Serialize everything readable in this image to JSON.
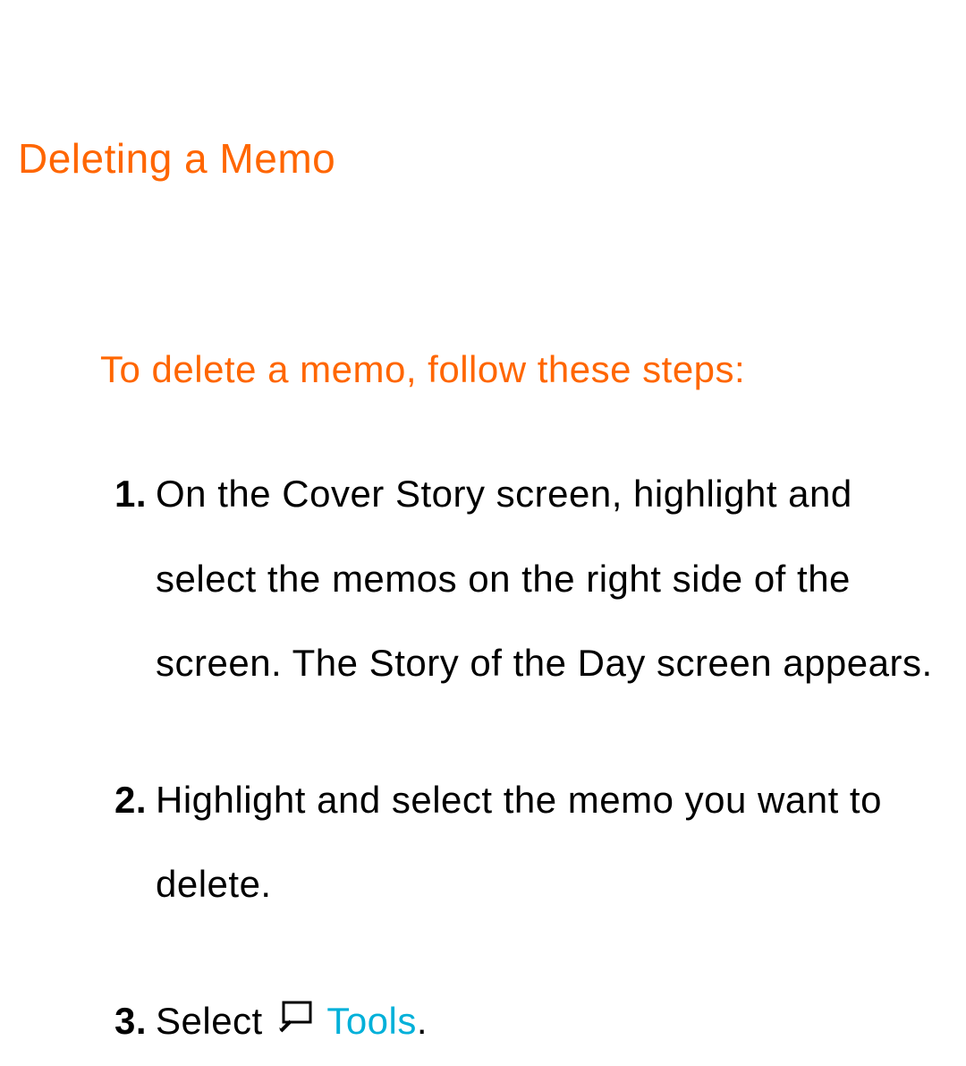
{
  "heading": "Deleting a Memo",
  "intro": "To delete a memo, follow these steps:",
  "steps": {
    "step1": "On the Cover Story screen, highlight and select the memos on the right side of the screen. The Story of the Day screen appears.",
    "step2": "Highlight and select the memo you want to delete.",
    "step3_prefix": "Select ",
    "step3_tools": "Tools",
    "step3_suffix": "."
  },
  "colors": {
    "accent": "#ff6600",
    "link": "#00b0d9",
    "text": "#000000"
  }
}
